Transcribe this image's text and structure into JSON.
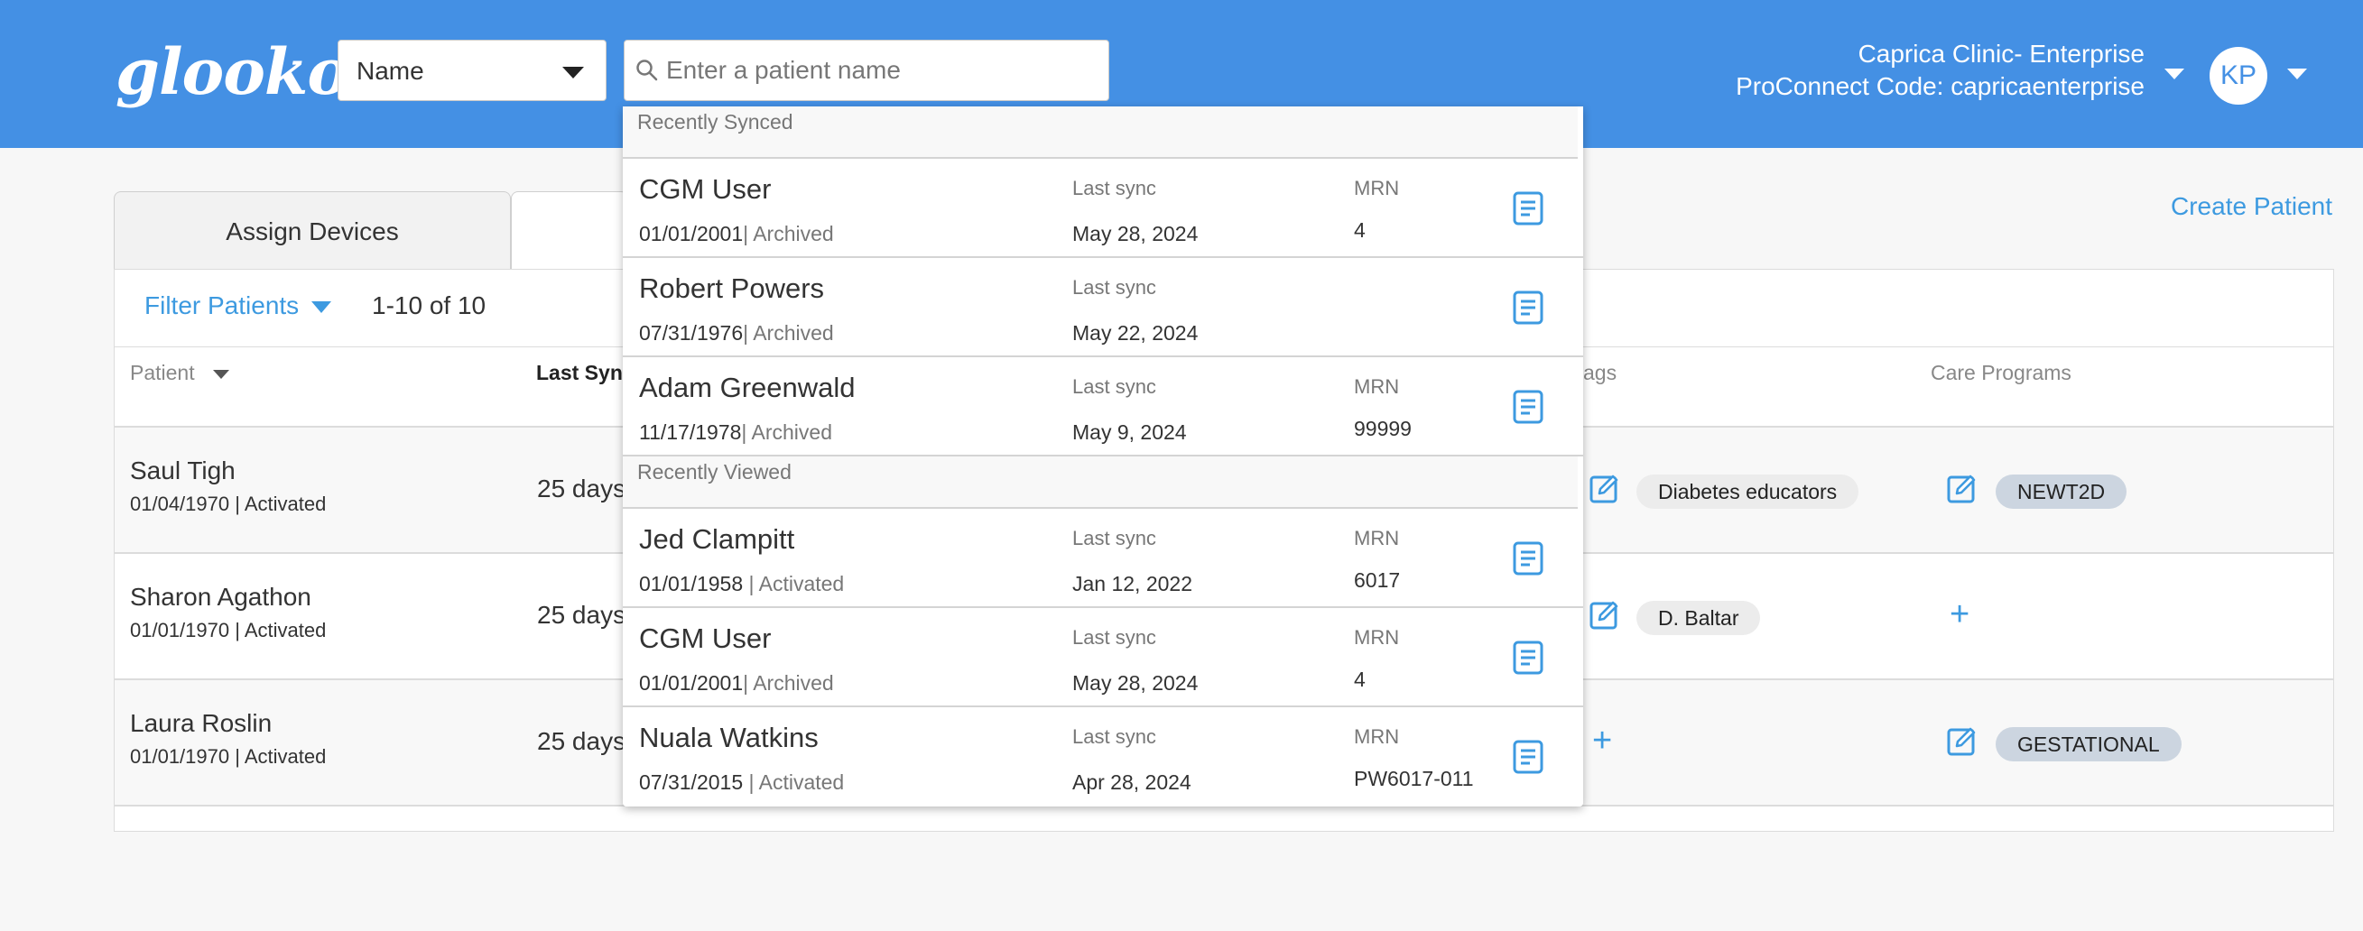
{
  "brand": {
    "logo_text": "glooko"
  },
  "header": {
    "search_type": "Name",
    "search_placeholder": "Enter a patient name",
    "clinic_name": "Caprica Clinic- Enterprise",
    "proconnect_code": "ProConnect Code: capricaenterprise",
    "avatar_initials": "KP"
  },
  "tabs": {
    "assign_devices": "Assign Devices"
  },
  "actions": {
    "create_patient": "Create Patient"
  },
  "toolbar": {
    "filter_label": "Filter Patients",
    "count": "1-10 of 10"
  },
  "columns": {
    "patient": "Patient",
    "last_sync": "Last Sync",
    "tags": "ags",
    "care_programs": "Care Programs"
  },
  "patients": [
    {
      "name": "Saul Tigh",
      "dob_status": "01/04/1970 | Activated",
      "last_sync": "25 days",
      "tag": "Diabetes educators",
      "program": "NEWT2D"
    },
    {
      "name": "Sharon Agathon",
      "dob_status": "01/01/1970 | Activated",
      "last_sync": "25 days",
      "tag": "D. Baltar",
      "program": ""
    },
    {
      "name": "Laura Roslin",
      "dob_status": "01/01/1970 | Activated",
      "last_sync": "25 days",
      "tag": "",
      "program": "GESTATIONAL"
    }
  ],
  "dropdown": {
    "recently_synced_label": "Recently Synced",
    "recently_viewed_label": "Recently Viewed",
    "last_sync_label": "Last sync",
    "mrn_label": "MRN",
    "synced": [
      {
        "name": "CGM User",
        "dob": "01/01/2001",
        "status": "| Archived",
        "last_sync": "May 28, 2024",
        "mrn": "4"
      },
      {
        "name": "Robert Powers",
        "dob": "07/31/1976",
        "status": "| Archived",
        "last_sync": "May 22, 2024",
        "mrn": ""
      },
      {
        "name": "Adam Greenwald",
        "dob": "11/17/1978",
        "status": "| Archived",
        "last_sync": "May 9, 2024",
        "mrn": "99999"
      }
    ],
    "viewed": [
      {
        "name": "Jed Clampitt",
        "dob": "01/01/1958",
        "status": " | Activated",
        "last_sync": "Jan 12, 2022",
        "mrn": "6017"
      },
      {
        "name": "CGM User",
        "dob": "01/01/2001",
        "status": "| Archived",
        "last_sync": "May 28, 2024",
        "mrn": "4"
      },
      {
        "name": "Nuala Watkins",
        "dob": "07/31/2015",
        "status": " | Activated",
        "last_sync": "Apr 28, 2024",
        "mrn": "PW6017-011"
      }
    ]
  },
  "colors": {
    "header_bg": "#4490e4",
    "accent": "#3d9ae0",
    "chip_program": "#ccd5e0",
    "chip_tag": "#ececec"
  }
}
